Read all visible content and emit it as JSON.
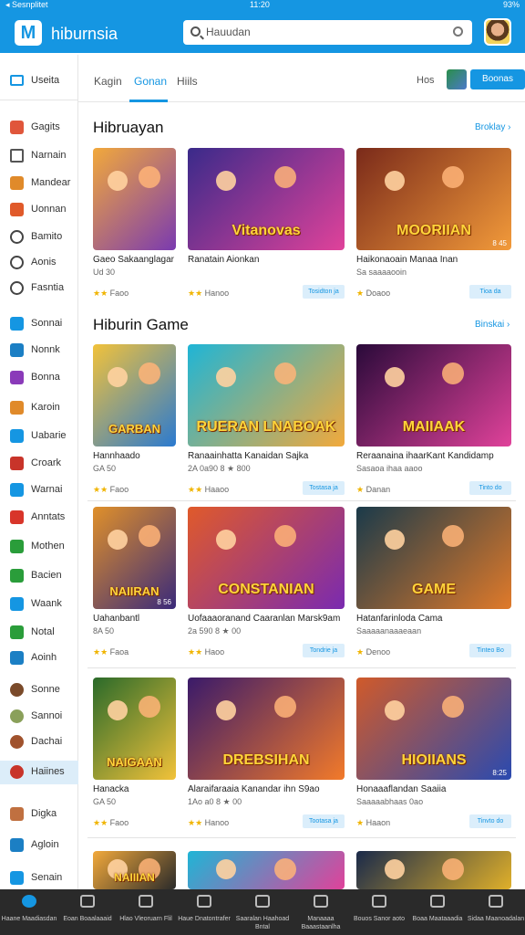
{
  "status_bar": {
    "carrier": "◂ Sesnplitet",
    "time": "11:20",
    "battery": "93%"
  },
  "app": {
    "logo_letter": "M",
    "name": "hiburnsia"
  },
  "search": {
    "placeholder": "Hauudan"
  },
  "sidebar": {
    "top_label": "Useita",
    "items": [
      {
        "label": "Gagits",
        "icon": "gamepad-icon",
        "color": "#e0563b"
      },
      {
        "label": "Narnain",
        "icon": "clipboard-icon",
        "color": "#555555"
      },
      {
        "label": "Mandear",
        "icon": "sparkle-icon",
        "color": "#e08a2a"
      },
      {
        "label": "Uonnan",
        "icon": "app-icon",
        "color": "#e05a2a"
      },
      {
        "label": "Bamito",
        "icon": "gear-icon",
        "color": "#444444"
      },
      {
        "label": "Aonis",
        "icon": "search-icon",
        "color": "#444444"
      },
      {
        "label": "Fasntia",
        "icon": "clock-icon",
        "color": "#444444"
      },
      {
        "label": "Sonnai",
        "icon": "badge-icon",
        "color": "#1596e2"
      },
      {
        "label": "Nonnk",
        "icon": "shield-icon",
        "color": "#1b7fc4"
      },
      {
        "label": "Bonna",
        "icon": "purple-app-icon",
        "color": "#8a3ab9"
      },
      {
        "label": "Karoin",
        "icon": "plane-icon",
        "color": "#e08a2a"
      },
      {
        "label": "Uabarie",
        "icon": "blue-app-icon",
        "color": "#1596e2"
      },
      {
        "label": "Croark",
        "icon": "red-app-icon",
        "color": "#c8342a"
      },
      {
        "label": "Warnai",
        "icon": "puzzle-icon",
        "color": "#1596e2"
      },
      {
        "label": "Anntats",
        "icon": "close-icon",
        "color": "#d8352a"
      },
      {
        "label": "Mothen",
        "icon": "leaf-icon",
        "color": "#2a9d3a"
      },
      {
        "label": "Bacien",
        "icon": "green-app-icon",
        "color": "#2a9d3a"
      },
      {
        "label": "Waank",
        "icon": "globe-icon",
        "color": "#1596e2"
      },
      {
        "label": "Notal",
        "icon": "chat-icon",
        "color": "#2a9d3a"
      },
      {
        "label": "Aoinh",
        "icon": "teal-app-icon",
        "color": "#1b7fc4"
      },
      {
        "label": "Sonne",
        "icon": "avatar-1",
        "color": "#7a4a2a"
      },
      {
        "label": "Sannoi",
        "icon": "avatar-2",
        "color": "#8aa05a"
      },
      {
        "label": "Dachai",
        "icon": "avatar-3",
        "color": "#a0522d"
      },
      {
        "label": "Haiines",
        "icon": "avatar-4",
        "color": "#c8342a",
        "selected": true
      },
      {
        "label": "Digka",
        "icon": "hand-icon",
        "color": "#c07040"
      },
      {
        "label": "Agloin",
        "icon": "globe-dark-icon",
        "color": "#1b7fc4"
      },
      {
        "label": "Senain",
        "icon": "globe-blue-icon",
        "color": "#1596e2"
      }
    ]
  },
  "tabs": {
    "items": [
      {
        "label": "Kagin"
      },
      {
        "label": "Gonan",
        "active": true
      },
      {
        "label": "Hiils"
      }
    ],
    "right_label": "Hos",
    "button_label": "Boonas"
  },
  "sections": [
    {
      "title": "Hibruayan",
      "link": "Broklay ›"
    },
    {
      "title": "Hiburin Game",
      "link": "Binskai ›"
    }
  ],
  "cards": [
    {
      "title_art": "",
      "name": "Gaeo Sakaanglagar",
      "sub": "Ud 30",
      "rating": "Faoo",
      "tag": "",
      "count": "",
      "colors": [
        "#f2a93b",
        "#7a3ab0"
      ]
    },
    {
      "title_art": "Vitanovas",
      "name": "Ranatain Aionkan",
      "sub": "",
      "rating": "Hanoo",
      "tag": "Tosidton ja",
      "count": "",
      "colors": [
        "#3a2a8a",
        "#e0429a"
      ]
    },
    {
      "title_art": "MOORIIAN",
      "name": "Haikonaoain Manaa Inan",
      "sub": "Sa saaaaooin",
      "rating": "Doaoo",
      "tag": "Tioa da",
      "count": "8 45",
      "colors": [
        "#7a2a1a",
        "#f29a3a"
      ]
    },
    {
      "title_art": "GARBAN",
      "name": "Hannhaado",
      "sub": "GA 50",
      "rating": "Faoo",
      "tag": "",
      "count": "",
      "colors": [
        "#f2c23a",
        "#2a7ad0"
      ]
    },
    {
      "title_art": "RUERAN LNABOAK",
      "name": "Ranaainhatta Kanaidan Sajka",
      "sub": "2A 0a90 8 ★ 800",
      "rating": "Haaoo",
      "tag": "Tostasa ja",
      "count": "",
      "colors": [
        "#1fb5d6",
        "#f2a93b"
      ]
    },
    {
      "title_art": "MAIIAAK",
      "name": "Reraanaina ihaarKant Kandidamp",
      "sub": "Sasaoa ihaa aaoo",
      "rating": "Danan",
      "tag": "Tinto do",
      "count": "",
      "colors": [
        "#2a0a3a",
        "#e0429a"
      ]
    },
    {
      "title_art": "NAIIRAN",
      "name": "Uahanbantl",
      "sub": "8A 50",
      "rating": "Faoa",
      "tag": "",
      "count": "8 56",
      "colors": [
        "#e0902a",
        "#3a2a7a"
      ]
    },
    {
      "title_art": "CONSTANIAN",
      "name": "Uofaaaoranand Caaranlan Marsk9am",
      "sub": "2a 590 8 ★ 00",
      "rating": "Haoo",
      "tag": "Tondrie ja",
      "count": "",
      "colors": [
        "#e05a2a",
        "#7a2ab0"
      ]
    },
    {
      "title_art": "GAME",
      "name": "Hatanfarinloda Cama",
      "sub": "Saaaaanaaaeaan",
      "rating": "Denoo",
      "tag": "Tinteo Bo",
      "count": "",
      "colors": [
        "#1a3a4a",
        "#e07a2a"
      ]
    },
    {
      "title_art": "NAIGAAN",
      "name": "Hanacka",
      "sub": "GA 50",
      "rating": "Faoo",
      "tag": "",
      "count": "",
      "colors": [
        "#2a6a2a",
        "#f2c23a"
      ]
    },
    {
      "title_art": "DREBSIHAN",
      "name": "Alaraifaraaia Kanandar ihn S9ao",
      "sub": "1Ao a0 8 ★ 00",
      "rating": "Hanoo",
      "tag": "Tootasa ja",
      "count": "",
      "colors": [
        "#3a1a6a",
        "#f27a2a"
      ]
    },
    {
      "title_art": "HIOIIANS",
      "name": "Honaaaflandan Saaiia",
      "sub": "Saaaaabhaas 0ao",
      "rating": "Haaon",
      "tag": "Tinvto do",
      "count": "8:25",
      "colors": [
        "#d05a2a",
        "#2a4ab0"
      ]
    },
    {
      "title_art": "NAIIIAN",
      "name": "",
      "sub": "",
      "rating": "",
      "tag": "",
      "count": "",
      "colors": [
        "#f2a93b",
        "#2a2a2a"
      ]
    },
    {
      "title_art": "",
      "name": "",
      "sub": "",
      "rating": "",
      "tag": "",
      "count": "",
      "colors": [
        "#1fb5d6",
        "#e0429a"
      ]
    },
    {
      "title_art": "",
      "name": "",
      "sub": "",
      "rating": "",
      "tag": "",
      "count": "",
      "colors": [
        "#1a2a4a",
        "#e0b02a"
      ]
    }
  ],
  "bottom_nav": [
    {
      "label": "Haane Maadiasdan",
      "icon": "home-globe-icon",
      "active": true
    },
    {
      "label": "Eoan Boaalaaaid",
      "icon": "home-icon"
    },
    {
      "label": "Hlao Vleoruarn Flil",
      "icon": "compass-icon"
    },
    {
      "label": "Haue Dnatontrafer",
      "icon": "calendar-icon"
    },
    {
      "label": "Saaralan Haahoad Bntal",
      "icon": "message-icon"
    },
    {
      "label": "Manaaaa Baaastaanlha",
      "icon": "grid-icon"
    },
    {
      "label": "Bouos Sanor aoto",
      "icon": "settings-icon"
    },
    {
      "label": "Boaa Maataaadia",
      "icon": "settings-icon-2"
    },
    {
      "label": "Sidaa Maanoadalan",
      "icon": "exit-icon"
    }
  ]
}
